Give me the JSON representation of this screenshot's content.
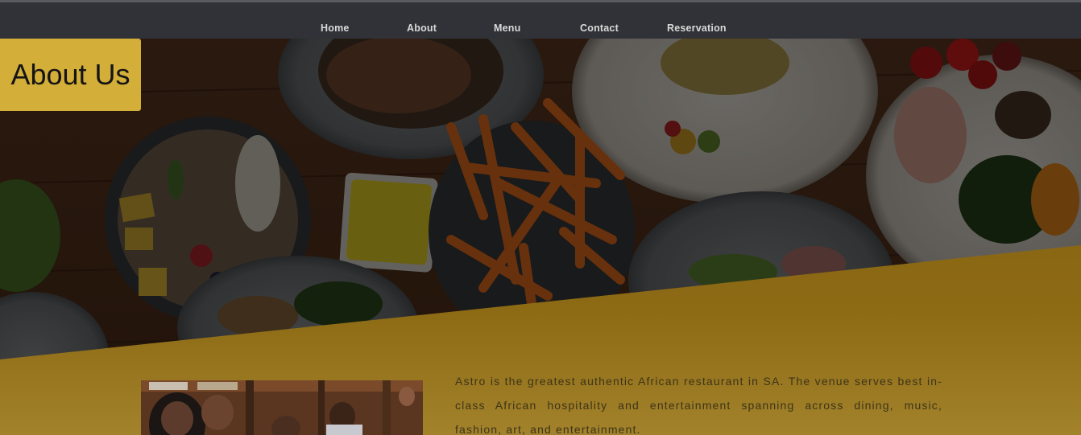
{
  "nav": {
    "items": [
      {
        "label": "Home"
      },
      {
        "label": "About"
      },
      {
        "label": "Menu"
      },
      {
        "label": "Contact"
      },
      {
        "label": "Reservation"
      }
    ]
  },
  "hero": {
    "title": "About Us"
  },
  "about": {
    "description": "Astro is the greatest authentic African restaurant in SA. The venue serves best in-class African hospitality and entertainment spanning across dining, music, fashion, art, and entertainment."
  },
  "colors": {
    "navbar": "#313237",
    "badge": "#d3ae38",
    "band": "#8d6a14",
    "text": "#3c3417"
  }
}
